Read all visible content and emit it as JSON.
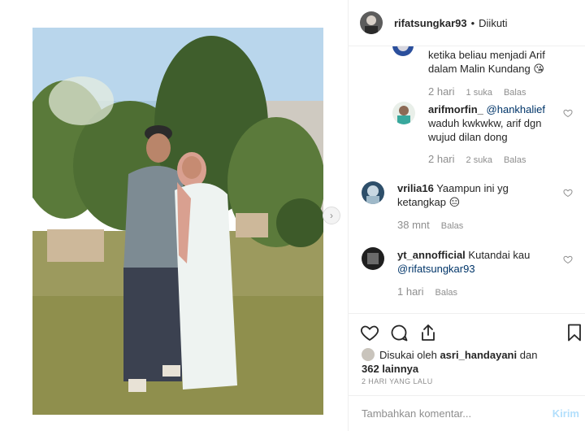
{
  "header": {
    "username": "rifatsungkar93",
    "separator": "•",
    "follow_status": "Diikuti"
  },
  "comments": [
    {
      "text_line1": "ketika beliau menjadi Arif",
      "text_line2": "dalam Malin Kundang",
      "emoji": "😘",
      "time": "2 hari",
      "likes": "1 suka",
      "reply": "Balas"
    },
    {
      "user": "arifmorfin_",
      "mention": "@hankhalief",
      "text_line1": "waduh kwkwkw, arif dgn",
      "text_line2": "wujud dilan dong",
      "time": "2 hari",
      "likes": "2 suka",
      "reply": "Balas"
    },
    {
      "user": "vrilia16",
      "text_line1": "Yaampun ini yg",
      "text_line2": "ketangkap",
      "emoji": "😑",
      "time": "38 mnt",
      "reply": "Balas"
    },
    {
      "user": "yt_annofficial",
      "text_line1": "Kutandai kau",
      "mention": "@rifatsungkar93",
      "time": "1 hari",
      "reply": "Balas"
    }
  ],
  "likes": {
    "prefix": "Disukai oleh",
    "user": "asri_handayani",
    "and": "dan",
    "count": "362 lainnya"
  },
  "post_date": "2 HARI YANG LALU",
  "composer": {
    "placeholder": "Tambahkan komentar...",
    "submit": "Kirim"
  },
  "icons": [
    "heart-icon",
    "comment-icon",
    "share-icon",
    "bookmark-icon",
    "chevron-right-icon"
  ]
}
